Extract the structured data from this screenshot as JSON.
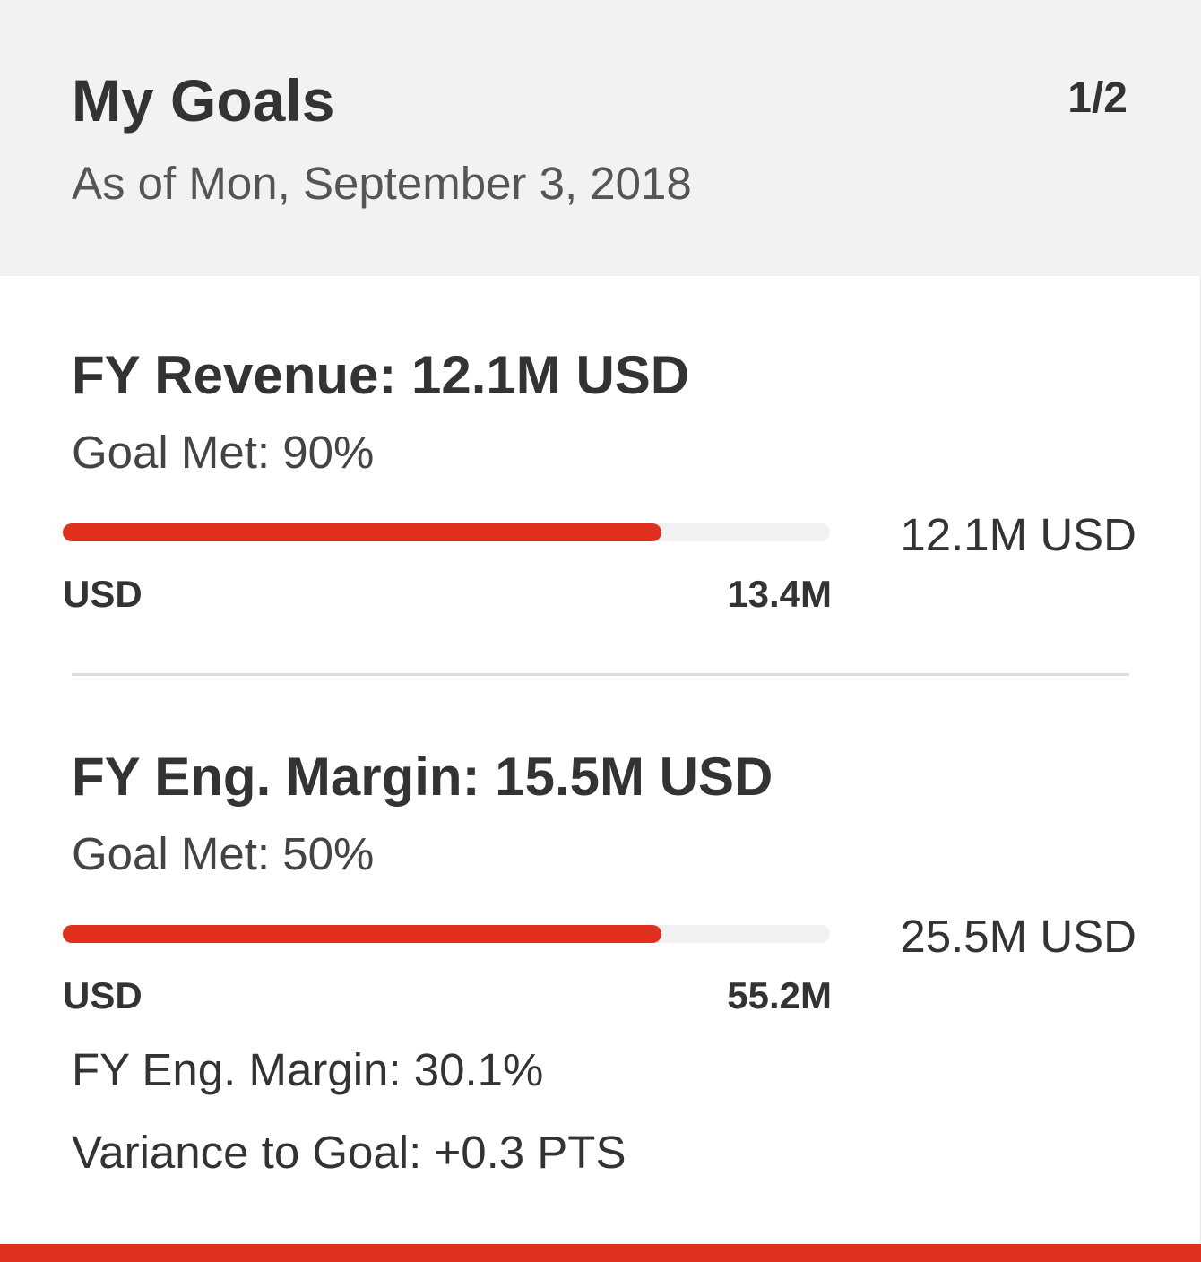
{
  "header": {
    "title": "My Goals",
    "subtitle": "As of Mon, September 3, 2018",
    "pager": "1/2"
  },
  "goals": [
    {
      "title": "FY Revenue: 12.1M USD",
      "goal_met": "Goal Met: 90%",
      "progress_fraction": 0.78,
      "bar_left_label": "USD",
      "bar_right_label": "13.4M",
      "actual": "12.1M USD"
    },
    {
      "title": "FY Eng. Margin: 15.5M USD",
      "goal_met": "Goal Met: 50%",
      "progress_fraction": 0.78,
      "bar_left_label": "USD",
      "bar_right_label": "55.2M",
      "actual": "25.5M USD",
      "extra_lines": [
        "FY Eng. Margin: 30.1%",
        "Variance to Goal: +0.3 PTS"
      ]
    }
  ],
  "colors": {
    "accent": "#e0301e",
    "track": "#f1f1f1",
    "header_bg": "#f2f2f2",
    "divider": "#dddddd"
  }
}
